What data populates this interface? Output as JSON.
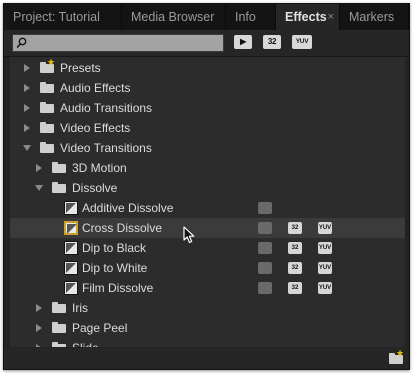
{
  "tabs": [
    {
      "label": "Project: Tutorial",
      "active": false
    },
    {
      "label": "Media Browser",
      "active": false
    },
    {
      "label": "Info",
      "active": false
    },
    {
      "label": "Effects",
      "active": true,
      "close_icon": "×"
    },
    {
      "label": "Markers",
      "active": false
    }
  ],
  "toolbar": {
    "search_value": "",
    "search_icon": "magnifier-icon",
    "buttons": [
      {
        "name": "accelerated-effects-filter",
        "label": "▶"
      },
      {
        "name": "32bit-filter",
        "label": "32"
      },
      {
        "name": "yuv-filter",
        "label": "YUV"
      }
    ]
  },
  "tree": [
    {
      "label": "Presets",
      "level": 0,
      "kind": "preset-folder",
      "expanded": false
    },
    {
      "label": "Audio Effects",
      "level": 0,
      "kind": "folder",
      "expanded": false
    },
    {
      "label": "Audio Transitions",
      "level": 0,
      "kind": "folder",
      "expanded": false
    },
    {
      "label": "Video Effects",
      "level": 0,
      "kind": "folder",
      "expanded": false
    },
    {
      "label": "Video Transitions",
      "level": 0,
      "kind": "folder",
      "expanded": true
    },
    {
      "label": "3D Motion",
      "level": 1,
      "kind": "folder",
      "expanded": false
    },
    {
      "label": "Dissolve",
      "level": 1,
      "kind": "folder",
      "expanded": true
    },
    {
      "label": "Additive Dissolve",
      "level": 2,
      "kind": "effect",
      "accelerated": false,
      "bit32": false,
      "yuv": false
    },
    {
      "label": "Cross Dissolve",
      "level": 2,
      "kind": "effect",
      "selected": true,
      "accelerated": false,
      "bit32": true,
      "yuv": true
    },
    {
      "label": "Dip to Black",
      "level": 2,
      "kind": "effect",
      "accelerated": false,
      "bit32": true,
      "yuv": true
    },
    {
      "label": "Dip to White",
      "level": 2,
      "kind": "effect",
      "accelerated": false,
      "bit32": true,
      "yuv": true
    },
    {
      "label": "Film Dissolve",
      "level": 2,
      "kind": "effect",
      "accelerated": false,
      "bit32": true,
      "yuv": true
    },
    {
      "label": "Iris",
      "level": 1,
      "kind": "folder",
      "expanded": false
    },
    {
      "label": "Page Peel",
      "level": 1,
      "kind": "folder",
      "expanded": false
    },
    {
      "label": "Slide",
      "level": 1,
      "kind": "folder",
      "expanded": false
    }
  ],
  "badges": {
    "accel": "",
    "bit32": "32",
    "yuv": "YUV"
  },
  "footer": {
    "new_bin_icon": "new-custom-bin-icon"
  },
  "colors": {
    "selection_outline": "#c9a227",
    "preset_star": "#f0c000"
  }
}
